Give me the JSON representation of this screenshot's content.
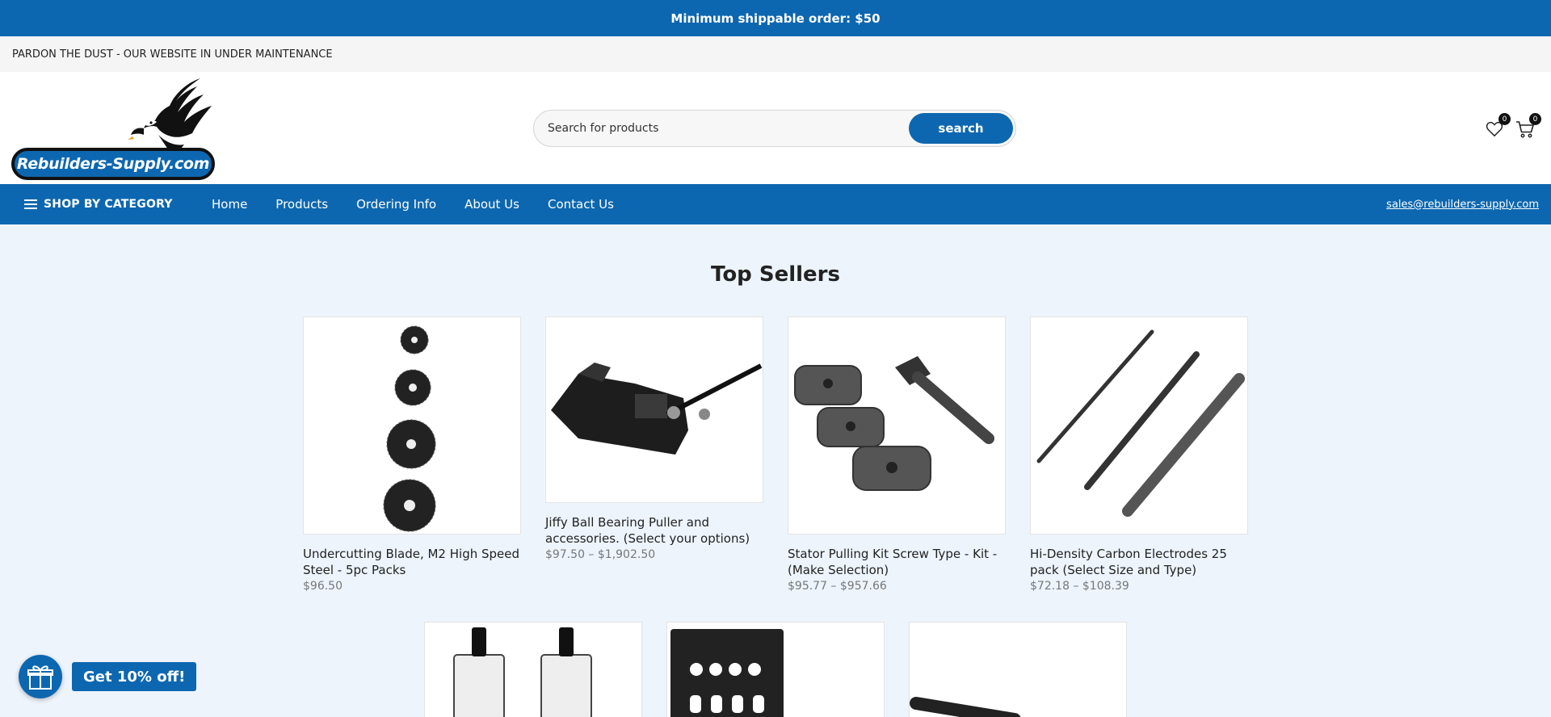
{
  "top_bar": {
    "text": "Minimum shippable order: $50"
  },
  "notice_bar": {
    "text": "PARDON THE DUST - OUR WEBSITE IN UNDER MAINTENANCE"
  },
  "logo": {
    "text": "Rebuilders-Supply.com"
  },
  "search": {
    "placeholder": "Search for products",
    "button_label": "search"
  },
  "header_icons": {
    "wishlist_count": "0",
    "cart_count": "0"
  },
  "nav": {
    "category_label": "SHOP BY CATEGORY",
    "links": [
      "Home",
      "Products",
      "Ordering Info",
      "About Us",
      "Contact Us"
    ],
    "email": "sales@rebuilders-supply.com"
  },
  "section": {
    "title": "Top Sellers"
  },
  "products": [
    {
      "name": "Undercutting Blade, M2 High Speed Steel - 5pc Packs",
      "price": "$96.50"
    },
    {
      "name": "Jiffy Ball Bearing Puller and accessories. (Select your options)",
      "price": "$97.50 – $1,902.50"
    },
    {
      "name": "Stator Pulling Kit Screw Type - Kit - (Make Selection)",
      "price": "$95.77 – $957.66"
    },
    {
      "name": "Hi-Density Carbon Electrodes 25 pack (Select Size and Type)",
      "price": "$72.18 – $108.39"
    }
  ],
  "promo": {
    "label": "Get 10% off!"
  },
  "colors": {
    "brand_blue": "#0d67b0",
    "page_bg": "#edf4fc"
  }
}
